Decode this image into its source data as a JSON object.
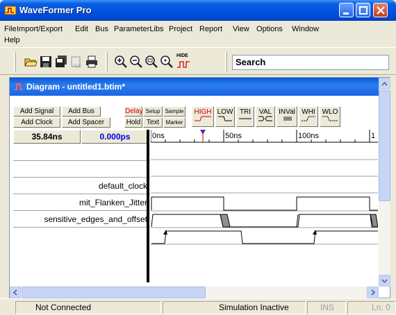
{
  "window": {
    "title": "WaveFormer Pro"
  },
  "menu": [
    "File",
    "Import/Export",
    "Edit",
    "Bus",
    "ParameterLibs",
    "Project",
    "Report",
    "View",
    "Options",
    "Window",
    "Help"
  ],
  "toolbar": {
    "search_text": "Search",
    "hide_label": "HIDE"
  },
  "document": {
    "title": "Diagram - untitled1.btim*"
  },
  "signal_buttons": {
    "add_signal": "Add Signal",
    "add_bus": "Add Bus",
    "add_clock": "Add Clock",
    "add_spacer": "Add Spacer",
    "delay": "Delay",
    "setup": "Setup",
    "sample": "Sample",
    "hold": "Hold",
    "text": "Text",
    "marker": "Marker"
  },
  "state_buttons": [
    "HIGH",
    "LOW",
    "TRI",
    "VAL",
    "INVal",
    "WHI",
    "WLO"
  ],
  "times": {
    "cursor": "35.84ns",
    "delta": "0.000ps"
  },
  "timeline": {
    "labels": [
      "0ns",
      "50ns",
      "100ns",
      "1"
    ]
  },
  "signals": [
    {
      "name": ""
    },
    {
      "name": ""
    },
    {
      "name": "default_clock"
    },
    {
      "name": "mit_Flanken_Jitter"
    },
    {
      "name": "sensitive_edges_and_offset"
    }
  ],
  "status": {
    "connection": "Not Connected",
    "simulation": "Simulation Inactive",
    "ins": "INS",
    "line": "Ln: 0"
  },
  "colors": {
    "titlebar": "#0054e3",
    "highlight": "#d00000",
    "delta": "#0000e0"
  }
}
